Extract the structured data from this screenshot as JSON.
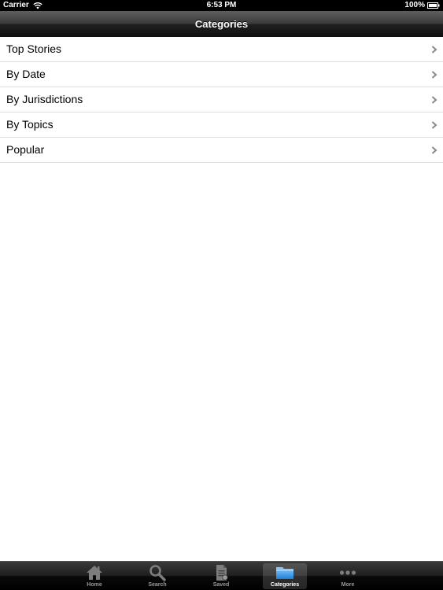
{
  "status_bar": {
    "carrier": "Carrier",
    "time": "6:53 PM",
    "battery": "100%",
    "icons": [
      "wifi-icon",
      "battery-icon"
    ]
  },
  "nav_bar": {
    "title": "Categories"
  },
  "list": {
    "items": [
      {
        "label": "Top Stories"
      },
      {
        "label": "By Date"
      },
      {
        "label": "By Jurisdictions"
      },
      {
        "label": "By Topics"
      },
      {
        "label": "Popular"
      }
    ],
    "accessory_icon": "chevron-right-icon"
  },
  "tab_bar": {
    "selected": "Categories",
    "tabs": [
      {
        "label": "Home",
        "icon": "home-icon"
      },
      {
        "label": "Search",
        "icon": "search-icon"
      },
      {
        "label": "Saved",
        "icon": "saved-document-icon"
      },
      {
        "label": "Categories",
        "icon": "folder-icon"
      },
      {
        "label": "More",
        "icon": "more-icon"
      }
    ]
  },
  "colors": {
    "nav_bar": "#2a2a2a",
    "tab_bar": "#1a1a1a",
    "tab_selected_label": "#ffffff",
    "tab_label": "#9a9a9a",
    "separator": "#e0e0e0",
    "chevron": "#8a8a8a"
  }
}
